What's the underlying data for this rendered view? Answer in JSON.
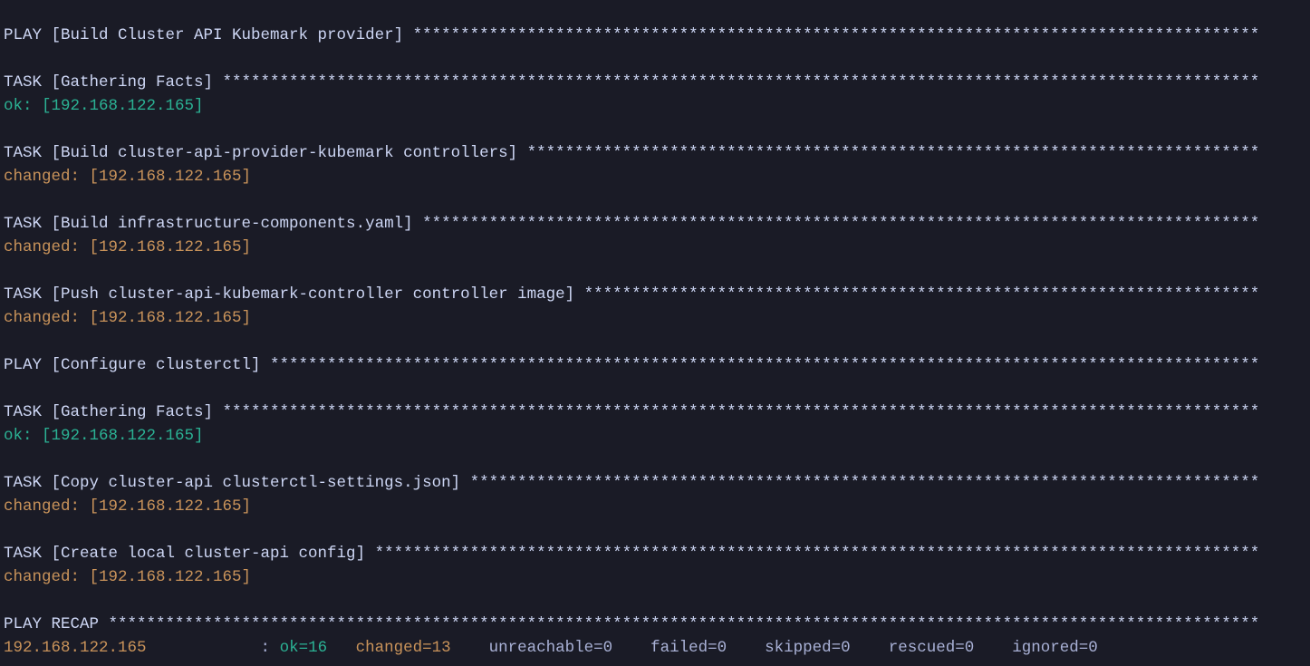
{
  "columns": 132,
  "host": "[192.168.122.165]",
  "recap_host": "192.168.122.165",
  "plays": [
    {
      "type": "play",
      "title": "PLAY [Build Cluster API Kubemark provider]"
    },
    {
      "type": "task",
      "title": "TASK [Gathering Facts]",
      "status": "ok"
    },
    {
      "type": "task",
      "title": "TASK [Build cluster-api-provider-kubemark controllers]",
      "status": "changed"
    },
    {
      "type": "task",
      "title": "TASK [Build infrastructure-components.yaml]",
      "status": "changed"
    },
    {
      "type": "task",
      "title": "TASK [Push cluster-api-kubemark-controller controller image]",
      "status": "changed"
    },
    {
      "type": "play",
      "title": "PLAY [Configure clusterctl]"
    },
    {
      "type": "task",
      "title": "TASK [Gathering Facts]",
      "status": "ok"
    },
    {
      "type": "task",
      "title": "TASK [Copy cluster-api clusterctl-settings.json]",
      "status": "changed"
    },
    {
      "type": "task",
      "title": "TASK [Create local cluster-api config]",
      "status": "changed"
    }
  ],
  "recap_title": "PLAY RECAP",
  "recap": {
    "ok": 16,
    "changed": 13,
    "unreachable": 0,
    "failed": 0,
    "skipped": 0,
    "rescued": 0,
    "ignored": 0
  }
}
